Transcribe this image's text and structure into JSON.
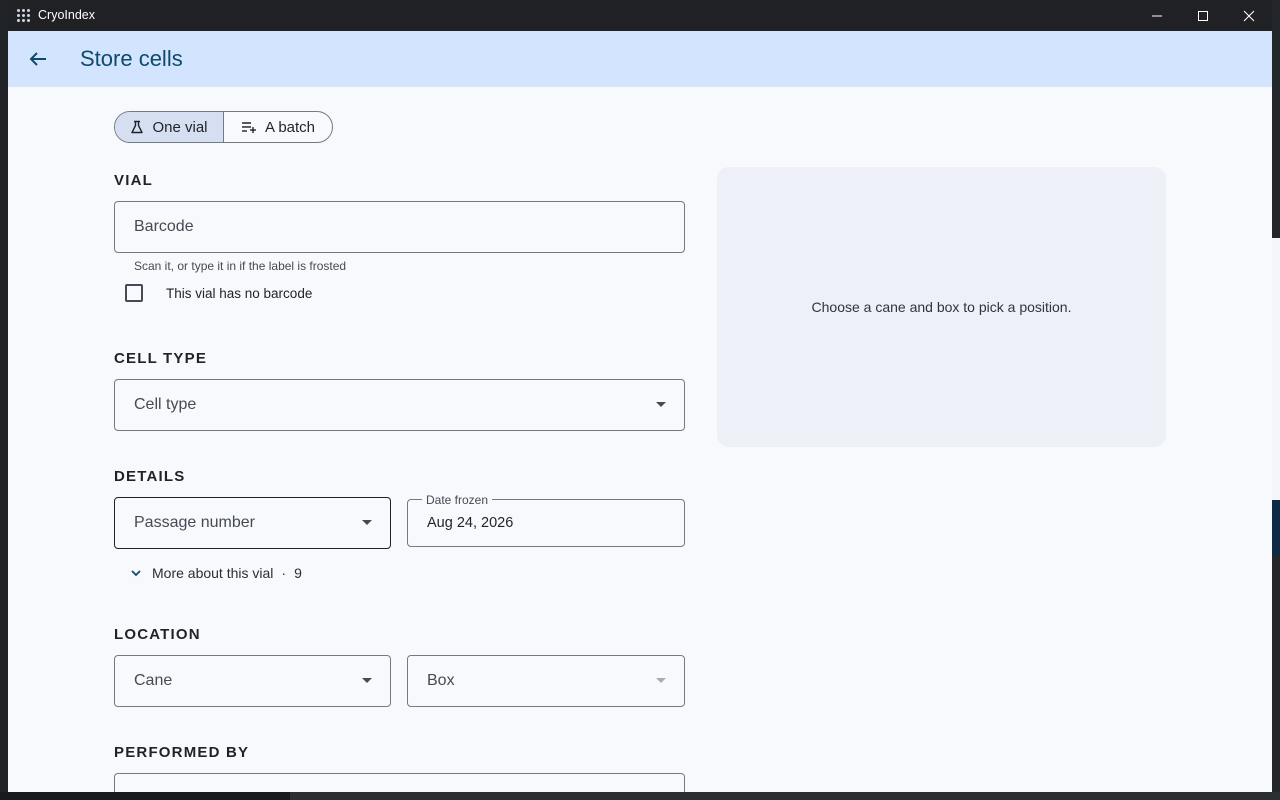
{
  "window": {
    "app_title": "CryoIndex",
    "icons": {
      "app": "grid-dots-icon",
      "minimize": "minimize-icon",
      "maximize": "maximize-icon",
      "close": "close-icon"
    }
  },
  "appbar": {
    "back_icon": "arrow-left-icon",
    "title": "Store cells",
    "color": "#d3e4ff"
  },
  "mode_toggle": {
    "options": [
      {
        "label": "One vial",
        "icon": "flask-icon",
        "selected": true
      },
      {
        "label": "A batch",
        "icon": "playlist-add-icon",
        "selected": false
      }
    ]
  },
  "vial": {
    "section_label": "VIAL",
    "barcode_placeholder": "Barcode",
    "barcode_helper": "Scan it, or type it in if the label is frosted",
    "no_barcode_label": "This vial has no barcode",
    "no_barcode_checked": false
  },
  "cell_type": {
    "section_label": "CELL TYPE",
    "placeholder": "Cell type"
  },
  "details": {
    "section_label": "DETAILS",
    "passage_placeholder": "Passage number",
    "date_label": "Date frozen",
    "date_value": "Aug 24, 2026",
    "more_label": "More about this vial",
    "more_separator": "·",
    "more_count": "9",
    "more_icon": "chevron-down-icon"
  },
  "location": {
    "section_label": "LOCATION",
    "cane_placeholder": "Cane",
    "box_placeholder": "Box",
    "box_disabled": true
  },
  "performed_by": {
    "section_label": "PERFORMED BY"
  },
  "position_panel": {
    "message": "Choose a cane and box to pick a position."
  }
}
